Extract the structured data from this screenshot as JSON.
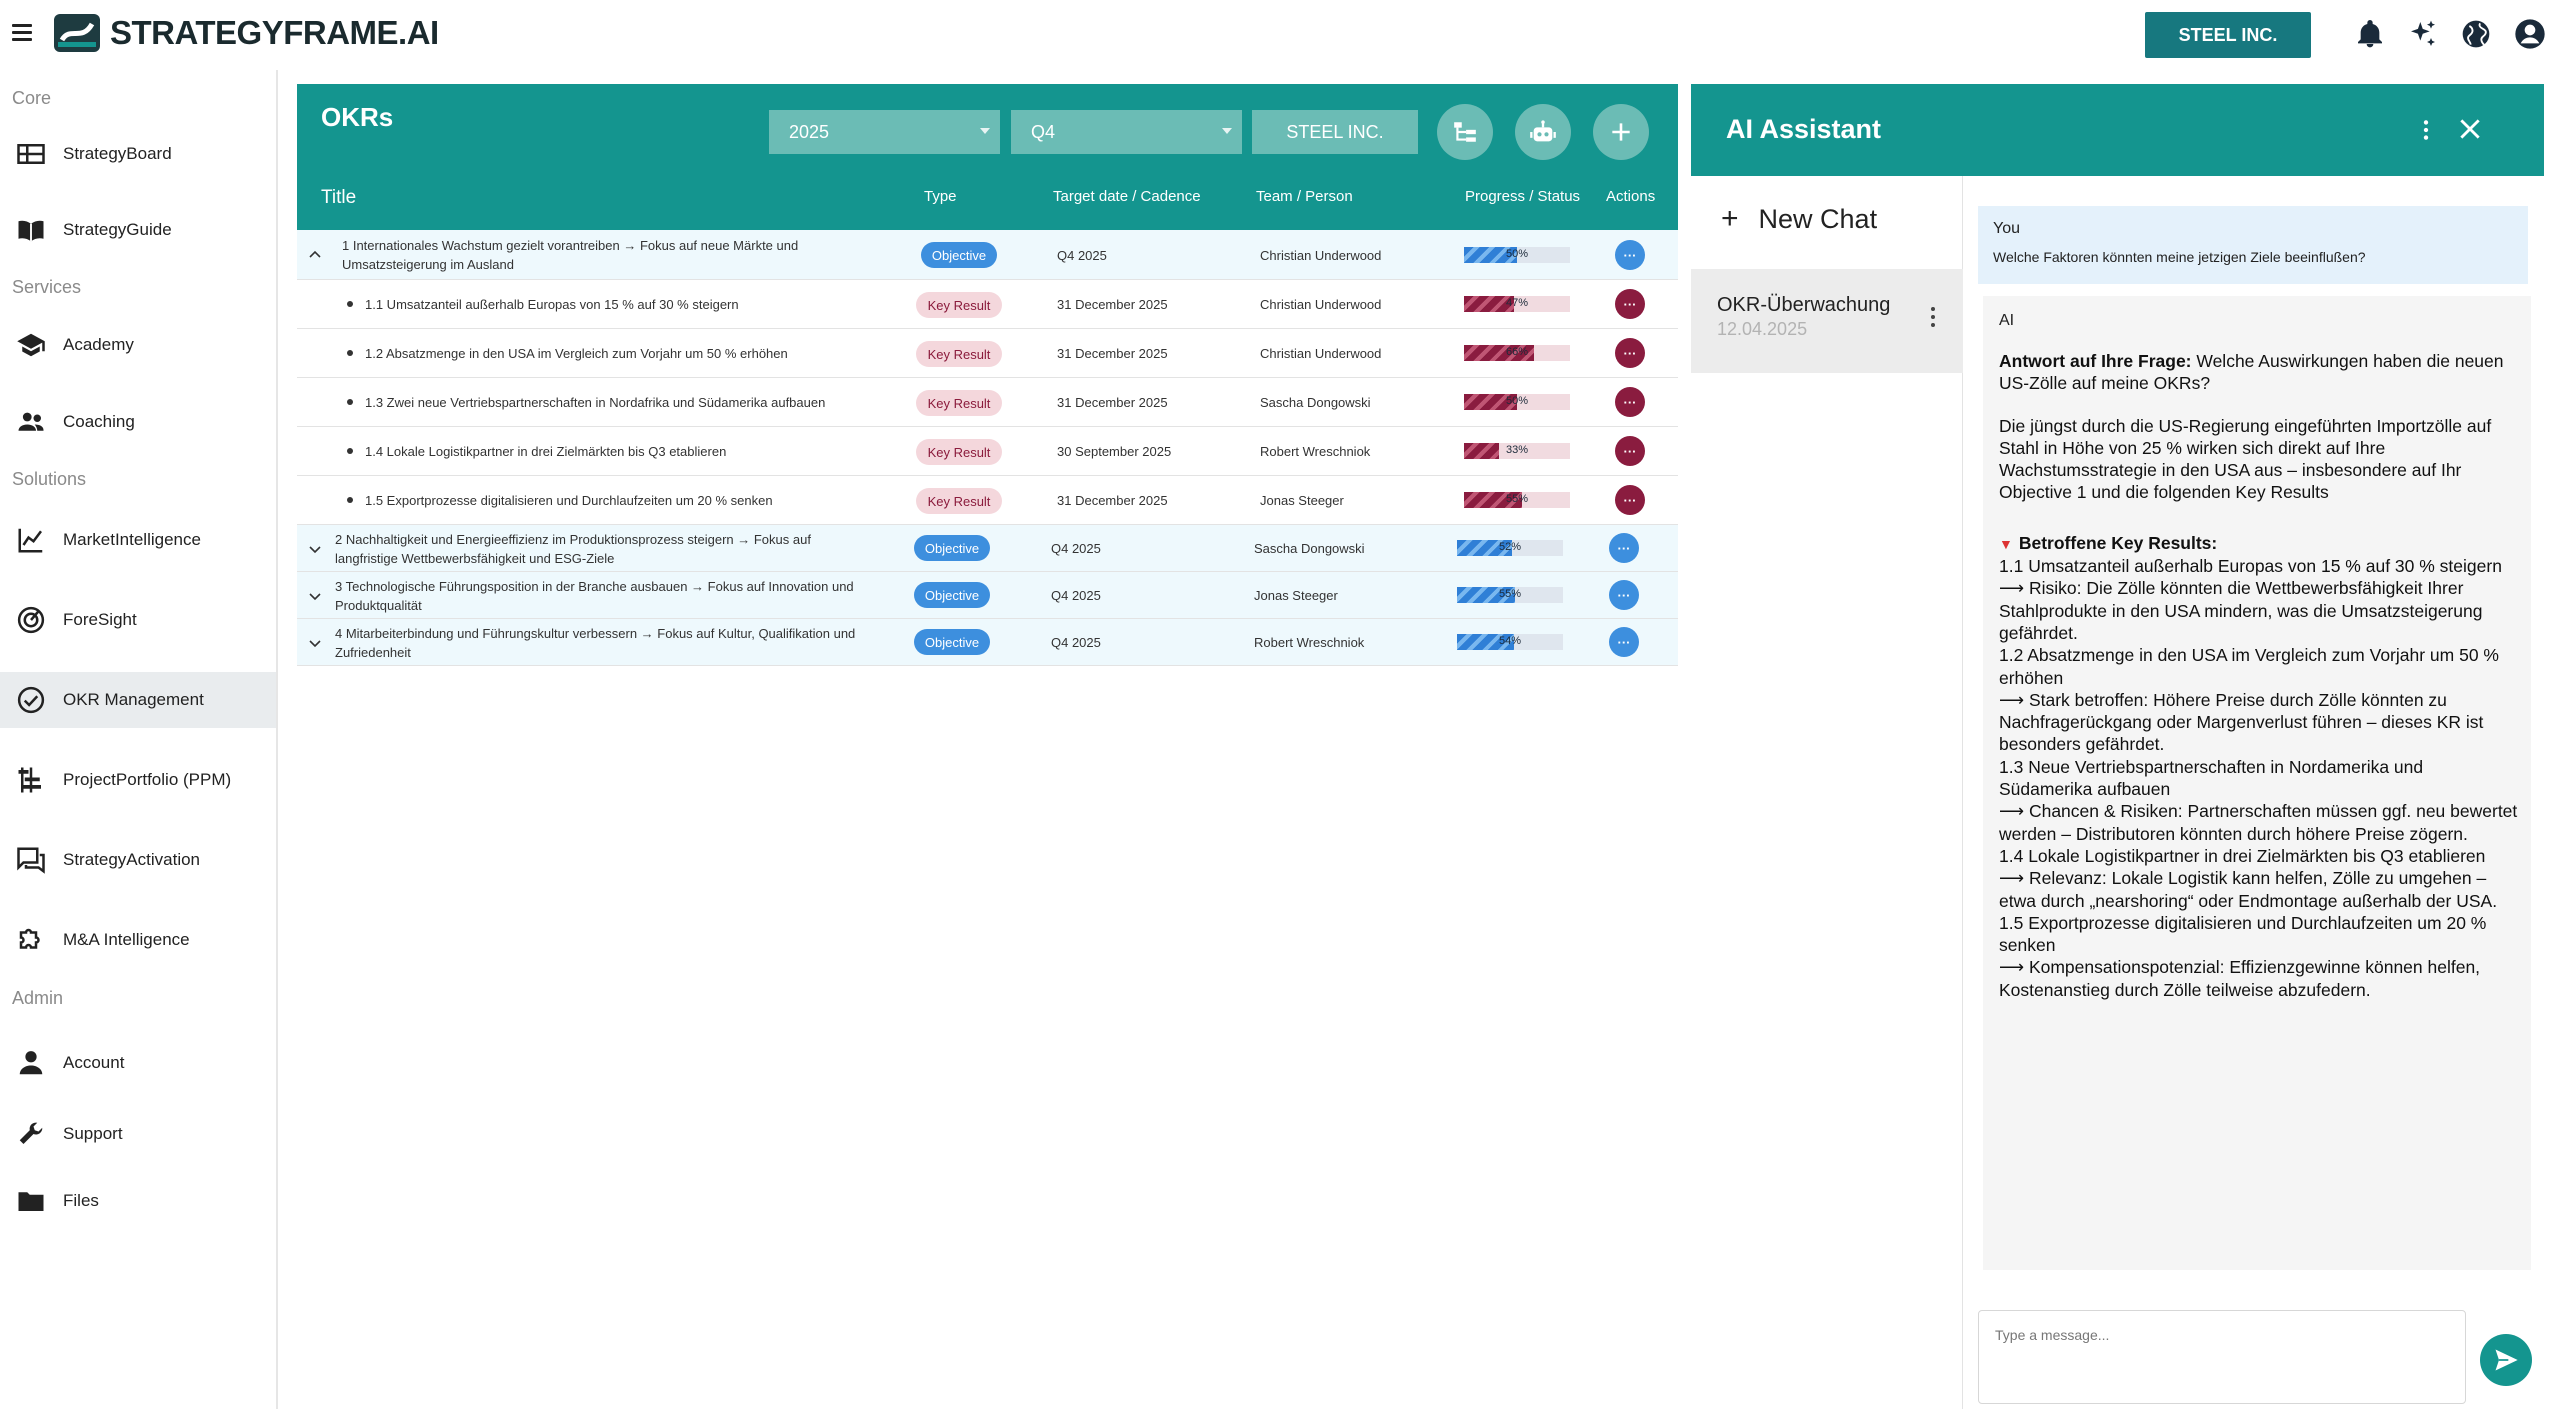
{
  "app": {
    "brand": "STRATEGYFRAME.AI",
    "company": "STEEL INC."
  },
  "sidebar": {
    "sections": [
      "Core",
      "Services",
      "Solutions",
      "Admin"
    ],
    "items": [
      {
        "label": "StrategyBoard",
        "icon": "board-icon"
      },
      {
        "label": "StrategyGuide",
        "icon": "book-icon"
      },
      {
        "label": "Academy",
        "icon": "graduation-cap-icon"
      },
      {
        "label": "Coaching",
        "icon": "people-icon"
      },
      {
        "label": "MarketIntelligence",
        "icon": "line-chart-icon"
      },
      {
        "label": "ForeSight",
        "icon": "radar-icon"
      },
      {
        "label": "OKR Management",
        "icon": "check-circle-icon"
      },
      {
        "label": "ProjectPortfolio (PPM)",
        "icon": "gantt-icon"
      },
      {
        "label": "StrategyActivation",
        "icon": "forum-icon"
      },
      {
        "label": "M&A Intelligence",
        "icon": "puzzle-icon"
      },
      {
        "label": "Account",
        "icon": "person-icon"
      },
      {
        "label": "Support",
        "icon": "wrench-icon"
      },
      {
        "label": "Files",
        "icon": "folder-icon"
      }
    ],
    "active": "OKR Management"
  },
  "okr": {
    "title": "OKRs",
    "year": "2025",
    "quarter": "Q4",
    "company": "STEEL INC.",
    "columns": {
      "title": "Title",
      "type": "Type",
      "target": "Target date / Cadence",
      "team": "Team / Person",
      "progress": "Progress / Status",
      "actions": "Actions"
    },
    "rows": [
      {
        "kind": "objective",
        "title": "1 Internationales Wachstum gezielt vorantreiben → Fokus auf neue Märkte und Umsatzsteigerung im Ausland",
        "type": "Objective",
        "target": "Q4 2025",
        "person": "Christian Underwood",
        "progress": 0.5,
        "progress_label": "50%",
        "expanded": true
      },
      {
        "kind": "kr",
        "title": "1.1 Umsatzanteil außerhalb Europas von 15 % auf 30 % steigern",
        "type": "Key Result",
        "target": "31 December 2025",
        "person": "Christian Underwood",
        "progress": 0.47,
        "progress_label": "47%"
      },
      {
        "kind": "kr",
        "title": "1.2 Absatzmenge in den USA im Vergleich zum Vorjahr um 50 % erhöhen",
        "type": "Key Result",
        "target": "31 December 2025",
        "person": "Christian Underwood",
        "progress": 0.66,
        "progress_label": "66%"
      },
      {
        "kind": "kr",
        "title": "1.3 Zwei neue Vertriebspartnerschaften in Nordafrika und Südamerika aufbauen",
        "type": "Key Result",
        "target": "31 December 2025",
        "person": "Sascha Dongowski",
        "progress": 0.5,
        "progress_label": "50%"
      },
      {
        "kind": "kr",
        "title": "1.4 Lokale Logistikpartner in drei Zielmärkten bis Q3 etablieren",
        "type": "Key Result",
        "target": "30 September 2025",
        "person": "Robert Wreschniok",
        "progress": 0.33,
        "progress_label": "33%"
      },
      {
        "kind": "kr",
        "title": "1.5 Exportprozesse digitalisieren und Durchlaufzeiten um 20 % senken",
        "type": "Key Result",
        "target": "31 December 2025",
        "person": "Jonas Steeger",
        "progress": 0.55,
        "progress_label": "55%"
      },
      {
        "kind": "objective",
        "title": "2 Nachhaltigkeit und Energieeffizienz im Produktionsprozess steigern → Fokus auf langfristige Wettbewerbsfähigkeit und ESG-Ziele",
        "type": "Objective",
        "target": "Q4 2025",
        "person": "Sascha Dongowski",
        "progress": 0.52,
        "progress_label": "52%",
        "expanded": false
      },
      {
        "kind": "objective",
        "title": "3 Technologische Führungsposition in der Branche ausbauen → Fokus auf Innovation und Produktqualität",
        "type": "Objective",
        "target": "Q4 2025",
        "person": "Jonas Steeger",
        "progress": 0.55,
        "progress_label": "55%",
        "expanded": false
      },
      {
        "kind": "objective",
        "title": "4 Mitarbeiterbindung und Führungskultur verbessern → Fokus auf Kultur, Qualifikation und Zufriedenheit",
        "type": "Objective",
        "target": "Q4 2025",
        "person": "Robert Wreschniok",
        "progress": 0.54,
        "progress_label": "54%",
        "expanded": false
      }
    ]
  },
  "assistant": {
    "title": "AI Assistant",
    "new_chat": "New Chat",
    "chats": [
      {
        "title": "OKR-Überwachung",
        "date": "12.04.2025"
      }
    ],
    "messages": {
      "you_label": "You",
      "you_text": "Welche Faktoren könnten meine jetzigen Ziele beeinflußen?",
      "ai_label": "AI",
      "ai_q_bold": "Antwort auf Ihre Frage:",
      "ai_q_rest": " Welche Auswirkungen haben die neuen US-Zölle auf meine OKRs?",
      "ai_para": "Die jüngst durch die US-Regierung eingeführten Importzölle auf Stahl in Höhe von 25 % wirken sich direkt auf Ihre Wachstumsstrategie in den USA aus – insbesondere auf Ihr Objective 1 und die folgenden Key Results",
      "ai_section": "Betroffene Key Results:",
      "ai_lines": [
        "1.1 Umsatzanteil außerhalb Europas von 15 % auf 30 % steigern",
        "⟶ Risiko: Die Zölle könnten die Wettbewerbsfähigkeit Ihrer Stahlprodukte in den USA mindern, was die Umsatzsteigerung gefährdet.",
        "1.2 Absatzmenge in den USA im Vergleich zum Vorjahr um 50 % erhöhen",
        "⟶ Stark betroffen: Höhere Preise durch Zölle könnten zu Nachfragerückgang oder Margenverlust führen – dieses KR ist besonders gefährdet.",
        "1.3 Neue Vertriebspartnerschaften in Nordamerika und Südamerika aufbauen",
        "⟶ Chancen & Risiken: Partnerschaften müssen ggf. neu bewertet werden – Distributoren könnten durch höhere Preise zögern.",
        "1.4 Lokale Logistikpartner in drei Zielmärkten bis Q3 etablieren",
        "⟶ Relevanz: Lokale Logistik kann helfen, Zölle zu umgehen – etwa durch „nearshoring“ oder Endmontage außerhalb der USA.",
        "1.5 Exportprozesse digitalisieren und Durchlaufzeiten um 20 % senken",
        "⟶ Kompensationspotenzial: Effizienzgewinne können helfen, Kostenanstieg durch Zölle teilweise abzufedern."
      ]
    },
    "input_placeholder": "Type a message..."
  },
  "colors": {
    "teal": "#14958f",
    "teal_light": "#6bbcb5",
    "objective_blue": "#3d8fde",
    "kr_red": "#8a1c3f"
  }
}
